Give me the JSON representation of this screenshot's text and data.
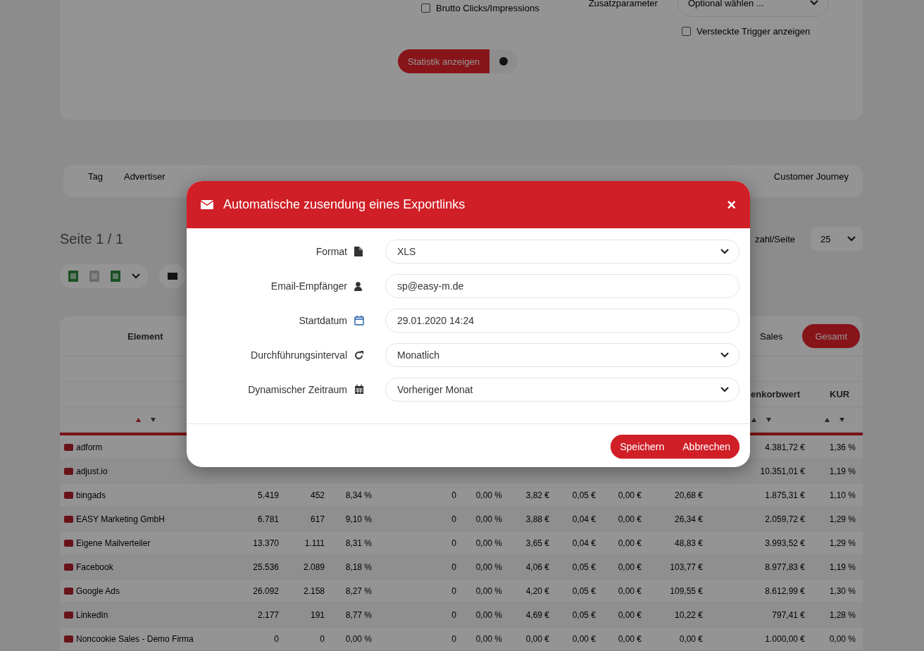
{
  "background": {
    "filters": {
      "checkboxes": [
        {
          "label": "Brutto Clicks/Impressions",
          "checked": false
        },
        {
          "label": "Versteckte Trigger anzeigen",
          "checked": false
        }
      ],
      "param_label": "Zusatzparameter",
      "param_select": "Optional wählen ...",
      "submit": "Statistik anzeigen"
    },
    "tabs": [
      {
        "label": "Tag"
      },
      {
        "label": "Advertiser"
      },
      {
        "label": "Customer Journey"
      }
    ],
    "page_title": "Seite 1 / 1",
    "per_page_label": "zahl/Seite",
    "per_page": "25",
    "table": {
      "element_header": "Element",
      "toggles": [
        {
          "label": "Sales",
          "selected": false
        },
        {
          "label": "Gesamt",
          "selected": true
        }
      ],
      "col_headers": [
        "enkorbwert",
        "KUR"
      ],
      "sort_markers": [
        {
          "selected": true
        },
        {
          "selected": false
        },
        {
          "selected": false
        }
      ],
      "rows": [
        {
          "name": "adform",
          "cells": [
            null,
            null,
            null,
            null,
            null,
            null,
            null,
            null,
            null,
            "4.381,72 €",
            "1,36 %"
          ]
        },
        {
          "name": "adjust.io",
          "cells": [
            null,
            null,
            null,
            null,
            null,
            null,
            null,
            null,
            null,
            "10.351,01 €",
            "1,19 %"
          ]
        },
        {
          "name": "bingads",
          "cells": [
            "5.419",
            "452",
            "8,34 %",
            "0",
            "0,00 %",
            "3,82 €",
            "0,05 €",
            "0,00 €",
            "20,68 €",
            "1.875,31 €",
            "1,10 %"
          ]
        },
        {
          "name": "EASY Marketing GmbH",
          "cells": [
            "6.781",
            "617",
            "9,10 %",
            "0",
            "0,00 %",
            "3,88 €",
            "0,04 €",
            "0,00 €",
            "26,34 €",
            "2.059,72 €",
            "1,29 %"
          ]
        },
        {
          "name": "Eigene Mailverteiler",
          "cells": [
            "13.370",
            "1.111",
            "8,31 %",
            "0",
            "0,00 %",
            "3,65 €",
            "0,04 €",
            "0,00 €",
            "48,83 €",
            "3.993,52 €",
            "1,29 %"
          ]
        },
        {
          "name": "Facebook",
          "cells": [
            "25.536",
            "2.089",
            "8,18 %",
            "0",
            "0,00 %",
            "4,06 €",
            "0,05 €",
            "0,00 €",
            "103,77 €",
            "8.977,83 €",
            "1,19 %"
          ]
        },
        {
          "name": "Google Ads",
          "cells": [
            "26.092",
            "2.158",
            "8,27 %",
            "0",
            "0,00 %",
            "4,20 €",
            "0,05 €",
            "0,00 €",
            "109,55 €",
            "8.612,99 €",
            "1,30 %"
          ]
        },
        {
          "name": "LinkedIn",
          "cells": [
            "2.177",
            "191",
            "8,77 %",
            "0",
            "0,00 %",
            "4,69 €",
            "0,05 €",
            "0,00 €",
            "10,22 €",
            "797,41 €",
            "1,28 %"
          ]
        },
        {
          "name": "Noncookie Sales - Demo Firma",
          "cells": [
            "0",
            "0",
            "0,00 %",
            "0",
            "0,00 %",
            "0,00 €",
            "0,00 €",
            "0,00 €",
            "0,00 €",
            "1.000,00 €",
            "0,00 %"
          ]
        }
      ]
    }
  },
  "dialog": {
    "title": "Automatische zusendung eines Exportlinks",
    "close": "×",
    "fields": [
      {
        "label": "Format",
        "kind": "select",
        "value": "XLS"
      },
      {
        "label": "Email-Empfänger",
        "kind": "input",
        "value": "sp@easy-m.de"
      },
      {
        "label": "Startdatum",
        "kind": "input",
        "value": "29.01.2020 14:24"
      },
      {
        "label": "Durchführungsinterval",
        "kind": "select",
        "value": "Monatlich"
      },
      {
        "label": "Dynamischer Zeitraum",
        "kind": "select",
        "value": "Vorheriger Monat"
      }
    ],
    "buttons": [
      {
        "label": "Speichern"
      },
      {
        "label": "Abbrechen"
      }
    ]
  }
}
